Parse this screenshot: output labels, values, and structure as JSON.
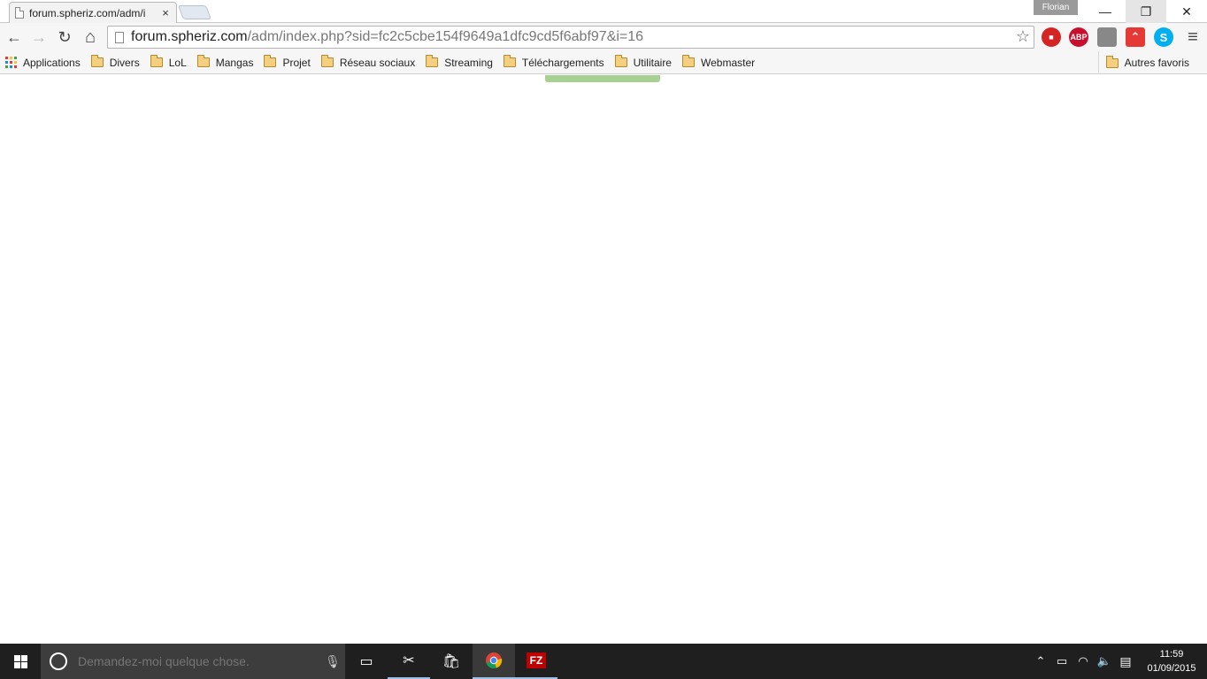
{
  "browser": {
    "tab": {
      "title": "forum.spheriz.com/adm/i",
      "close": "×"
    },
    "profile": "Florian",
    "window": {
      "minimize": "—",
      "restore": "❐",
      "close": "✕"
    },
    "nav": {
      "back": "←",
      "forward": "→",
      "reload": "↻",
      "home": "⌂",
      "menu": "≡"
    },
    "url": {
      "host": "forum.spheriz.com",
      "path": "/adm/index.php?sid=fc2c5cbe154f9649a1dfc9cd5f6abf97&i=16"
    },
    "extensions": {
      "stop": {
        "label": "■",
        "color": "#d42424"
      },
      "abp": {
        "label": "ABP",
        "color": "#c8102e"
      },
      "ext3": {
        "label": "",
        "color": "#888888"
      },
      "ext4": {
        "label": "⌃",
        "color": "#e53935"
      },
      "skype": {
        "label": "S",
        "color": "#00aff0"
      }
    }
  },
  "bookmarks": {
    "apps": "Applications",
    "items": [
      "Divers",
      "LoL",
      "Mangas",
      "Projet",
      "Réseau sociaux",
      "Streaming",
      "Téléchargements",
      "Utilitaire",
      "Webmaster"
    ],
    "other": "Autres favoris"
  },
  "page": {
    "accent": "#a7d193"
  },
  "taskbar": {
    "search_placeholder": "Demandez-moi quelque chose.",
    "clock_time": "11:59",
    "clock_date": "01/09/2015"
  }
}
